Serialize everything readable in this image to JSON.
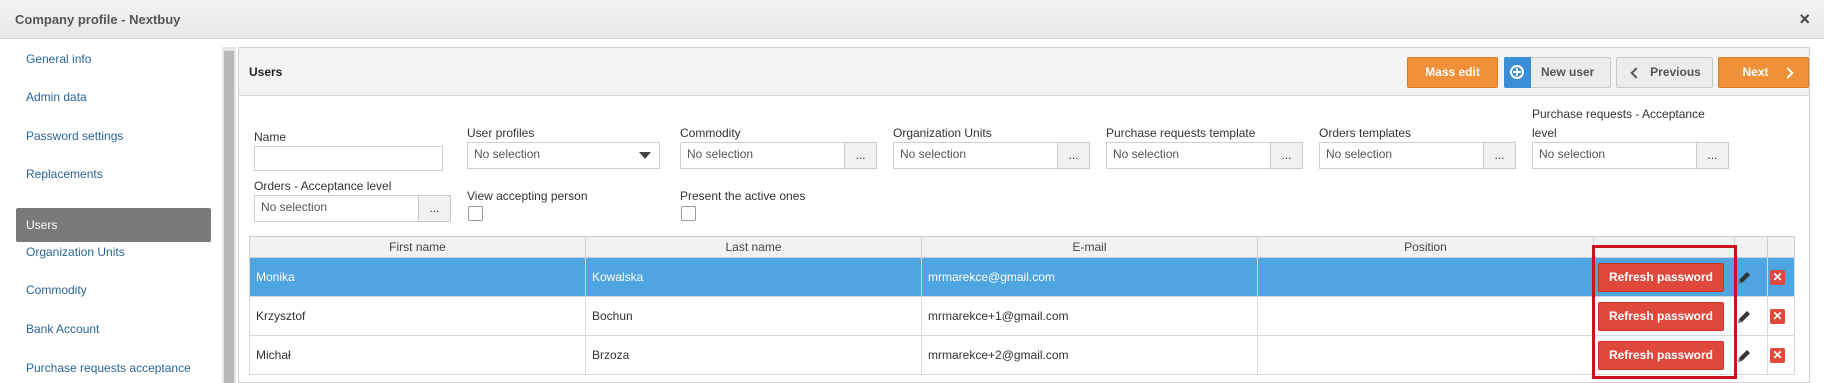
{
  "window": {
    "title": "Company profile - Nextbuy",
    "close_symbol": "×"
  },
  "sidebar": {
    "items": [
      {
        "label": "General info",
        "active": false
      },
      {
        "label": "Admin data",
        "active": false
      },
      {
        "label": "Password settings",
        "active": false
      },
      {
        "label": "Replacements",
        "active": false
      },
      {
        "label": "Users",
        "active": true
      },
      {
        "label": "Organization Units",
        "active": false
      },
      {
        "label": "Commodity",
        "active": false
      },
      {
        "label": "Bank Account",
        "active": false
      },
      {
        "label": "Purchase requests acceptance",
        "active": false
      }
    ]
  },
  "panel": {
    "title": "Users",
    "buttons": {
      "mass_edit": "Mass edit",
      "new_user": "New user",
      "previous": "Previous",
      "next": "Next"
    }
  },
  "filters": {
    "name": {
      "label": "Name",
      "value": ""
    },
    "user_profiles": {
      "label": "User profiles",
      "value": "No selection"
    },
    "commodity": {
      "label": "Commodity",
      "value": "No selection",
      "button": "..."
    },
    "organization_units": {
      "label": "Organization Units",
      "value": "No selection",
      "button": "..."
    },
    "pr_template": {
      "label": "Purchase requests template",
      "value": "No selection",
      "button": "..."
    },
    "orders_templates": {
      "label": "Orders templates",
      "value": "No selection",
      "button": "..."
    },
    "pr_acceptance": {
      "label_line1": "Purchase requests - Acceptance",
      "label_line2": "level",
      "value": "No selection",
      "button": "..."
    },
    "orders_acceptance": {
      "label": "Orders - Acceptance level",
      "value": "No selection",
      "button": "..."
    },
    "view_accepting": {
      "label": "View accepting person",
      "checked": false
    },
    "present_active": {
      "label": "Present the active ones",
      "checked": false
    }
  },
  "table": {
    "columns": [
      "First name",
      "Last name",
      "E-mail",
      "Position"
    ],
    "refresh_label": "Refresh password",
    "delete_symbol": "✕",
    "rows": [
      {
        "first_name": "Monika",
        "last_name": "Kowalska",
        "email": "mrmarekce@gmail.com",
        "position": "",
        "selected": true
      },
      {
        "first_name": "Krzysztof",
        "last_name": "Bochun",
        "email": "mrmarekce+1@gmail.com",
        "position": "",
        "selected": false
      },
      {
        "first_name": "Michał",
        "last_name": "Brzoza",
        "email": "mrmarekce+2@gmail.com",
        "position": "",
        "selected": false
      }
    ]
  },
  "colors": {
    "accent_orange": "#f0913a",
    "selected_row": "#4fa5df",
    "danger": "#e0483c",
    "highlight": "#c8141b",
    "link": "#2a6496"
  }
}
